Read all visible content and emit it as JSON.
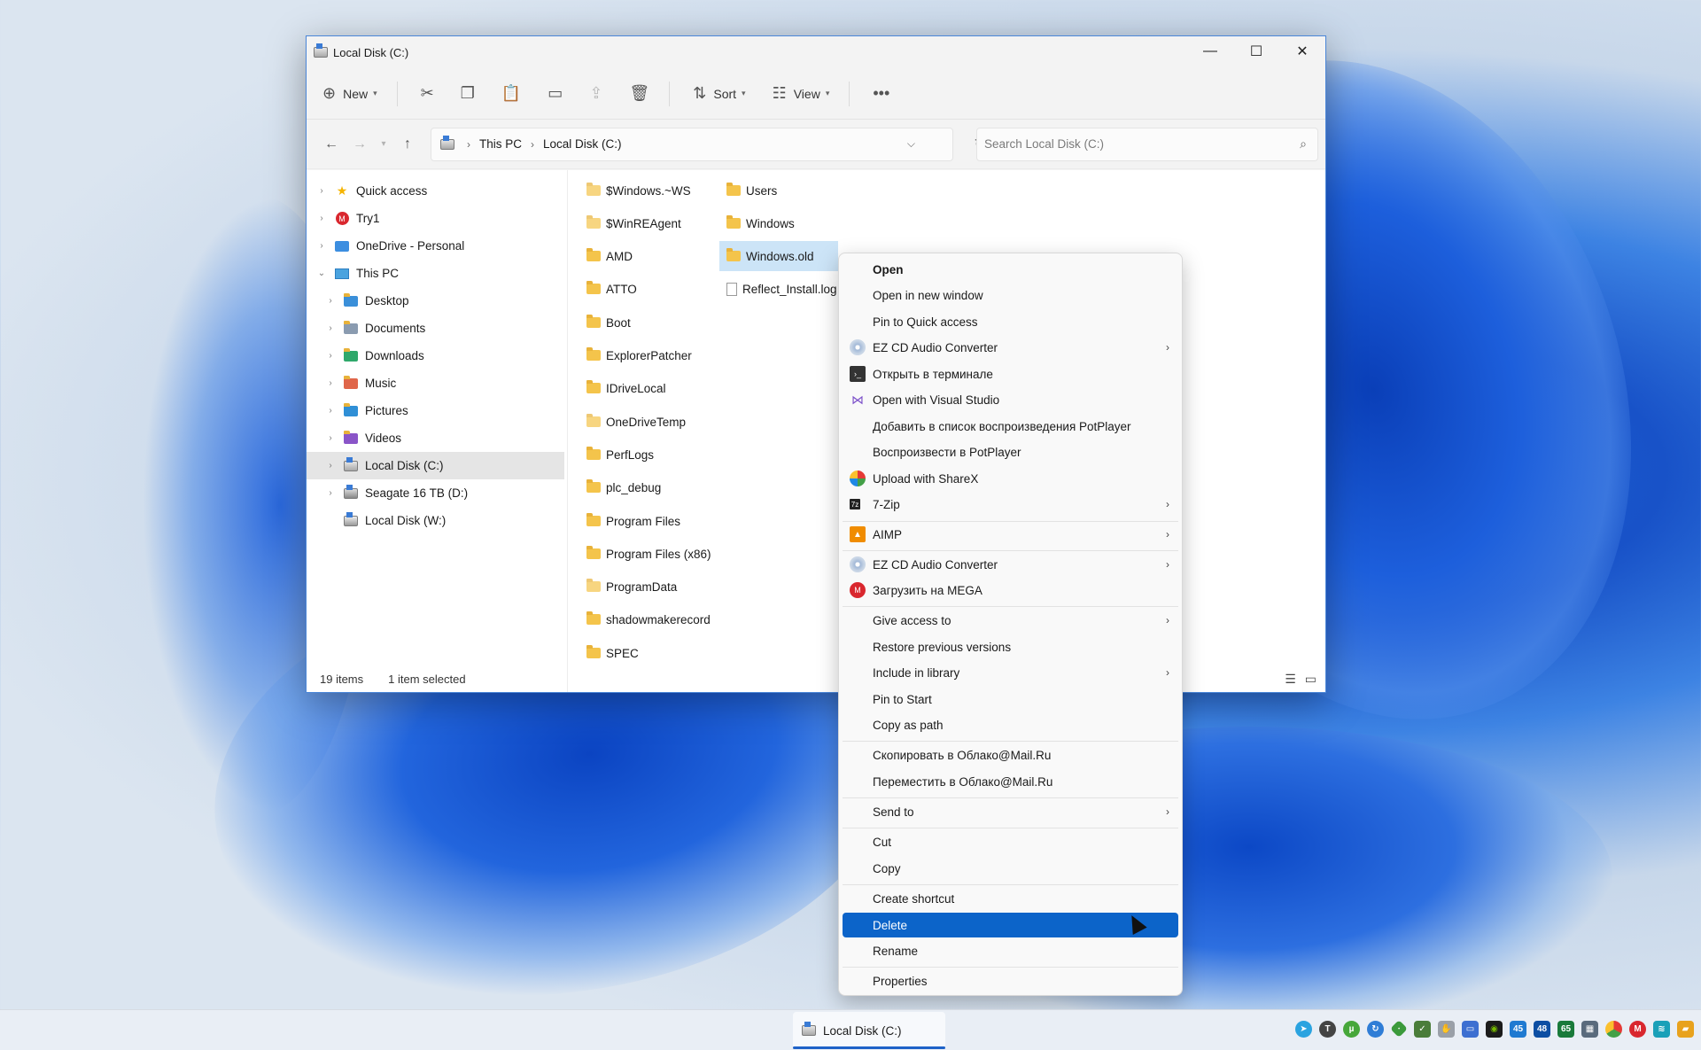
{
  "window": {
    "title": "Local Disk (C:)",
    "controls": {
      "minimize": "—",
      "maximize": "☐",
      "close": "✕"
    }
  },
  "toolbar": {
    "new_label": "New",
    "sort_label": "Sort",
    "view_label": "View",
    "more": "•••"
  },
  "nav": {
    "breadcrumb": [
      "This PC",
      "Local Disk (C:)"
    ],
    "search_placeholder": "Search Local Disk (C:)"
  },
  "sidebar": {
    "items": [
      {
        "label": "Quick access",
        "icon": "star-icon"
      },
      {
        "label": "Try1",
        "icon": "mega-icon"
      },
      {
        "label": "OneDrive - Personal",
        "icon": "onedrive-icon"
      },
      {
        "label": "This PC",
        "icon": "computer-icon"
      },
      {
        "label": "Desktop",
        "icon": "desktop-icon"
      },
      {
        "label": "Documents",
        "icon": "documents-icon"
      },
      {
        "label": "Downloads",
        "icon": "downloads-icon"
      },
      {
        "label": "Music",
        "icon": "music-icon"
      },
      {
        "label": "Pictures",
        "icon": "pictures-icon"
      },
      {
        "label": "Videos",
        "icon": "videos-icon"
      },
      {
        "label": "Local Disk (C:)",
        "icon": "drive-icon"
      },
      {
        "label": "Seagate 16 TB (D:)",
        "icon": "drive-icon"
      },
      {
        "label": "Local Disk (W:)",
        "icon": "drive-icon"
      }
    ]
  },
  "files": {
    "col1": [
      "$Windows.~WS",
      "$WinREAgent",
      "AMD",
      "ATTO",
      "Boot",
      "ExplorerPatcher",
      "IDriveLocal",
      "OneDriveTemp",
      "PerfLogs",
      "plc_debug",
      "Program Files",
      "Program Files (x86)",
      "ProgramData",
      "shadowmakerecord",
      "SPEC"
    ],
    "col2": [
      "Users",
      "Windows",
      "Windows.old",
      "Reflect_Install.log"
    ]
  },
  "status": {
    "count": "19 items",
    "selected": "1 item selected"
  },
  "context_menu": {
    "items": [
      "Open",
      "Open in new window",
      "Pin to Quick access",
      "EZ CD Audio Converter",
      "Открыть в терминале",
      "Open with Visual Studio",
      "Добавить в список воспроизведения PotPlayer",
      "Воспроизвести в PotPlayer",
      "Upload with ShareX",
      "7-Zip",
      "AIMP",
      "EZ CD Audio Converter",
      "Загрузить на MEGA",
      "Give access to",
      "Restore previous versions",
      "Include in library",
      "Pin to Start",
      "Copy as path",
      "Скопировать в Облако@Mail.Ru",
      "Переместить в Облако@Mail.Ru",
      "Send to",
      "Cut",
      "Copy",
      "Create shortcut",
      "Delete",
      "Rename",
      "Properties"
    ],
    "highlighted": "Delete"
  },
  "taskbar": {
    "app_label": "Local Disk (C:)",
    "tray_badges": [
      "45",
      "48",
      "65"
    ]
  },
  "colors": {
    "accent": "#0c64c9",
    "selection": "#cce4f7",
    "folder": "#f4c44b"
  }
}
